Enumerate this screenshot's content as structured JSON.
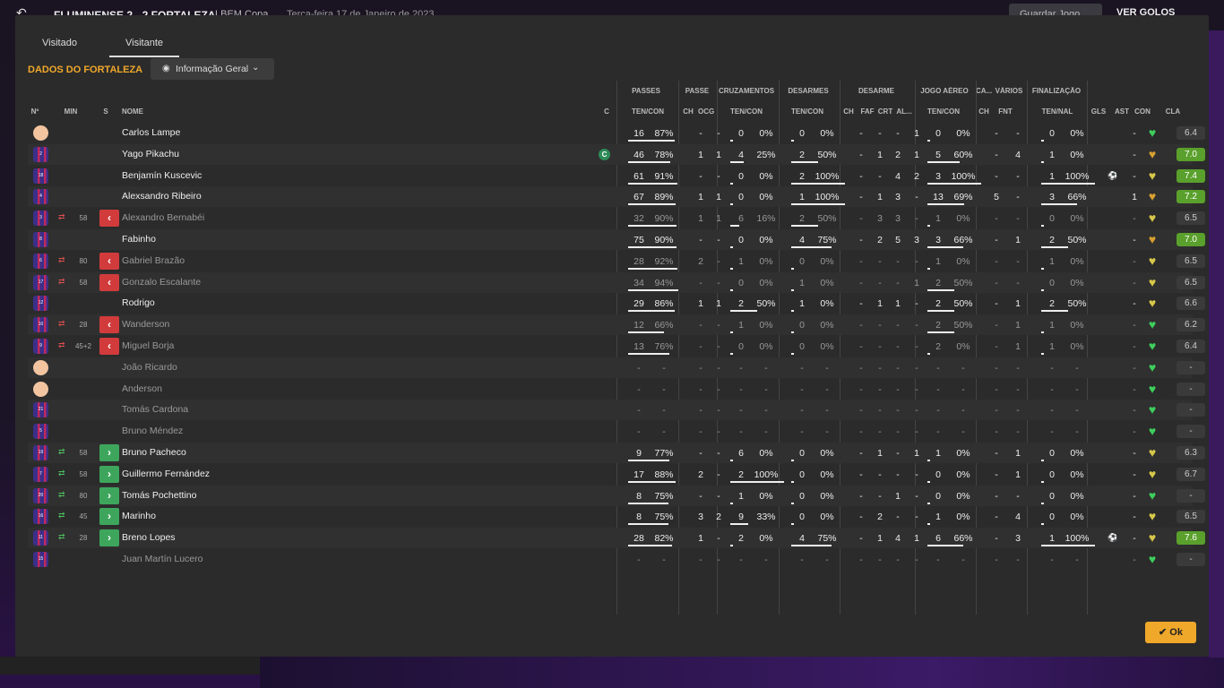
{
  "topbar": {
    "match": "FLUMINENSE  2 - 2  FORTALEZA",
    "competition": "LBEM Copa",
    "date": "Terça-feira 17 de Janeiro de 2023",
    "save_label": "Guardar Jogo",
    "goals_label": "VER GOLOS"
  },
  "tabs": [
    "Visitado",
    "Visitante"
  ],
  "section_title": "DADOS DO FORTALEZA",
  "info_button": "Informação Geral",
  "headers": {
    "left": [
      "Nº",
      "MIN",
      "S",
      "NOME",
      "C"
    ],
    "groups": [
      "PASSES",
      "PASSE",
      "CRUZAMENTOS",
      "DESARMES",
      "DESARME",
      "JOGO AÉREO",
      "CA...",
      "VÁRIOS",
      "FINALIZAÇÃO"
    ],
    "cols": [
      "TEN/CON",
      "CH",
      "OCG",
      "TEN/CON",
      "TEN/CON",
      "CH",
      "FAF",
      "CRT",
      "AL...",
      "TEN/CON",
      "CH",
      "FNT",
      "TEN/NAL",
      "GLS",
      "AST",
      "CON",
      "CLA"
    ]
  },
  "ok_label": "Ok",
  "players": [
    {
      "no": "",
      "face": true,
      "min": "",
      "sub": "",
      "name": "Carlos Lampe",
      "cap": false,
      "dim": false,
      "p": [
        "16",
        "87%"
      ],
      "pb": 0.87,
      "ch": "-",
      "ocg": "-",
      "cr": [
        "0",
        "0%"
      ],
      "crb": 0,
      "ds": [
        "0",
        "0%"
      ],
      "dsb": 0,
      "d": [
        "-",
        "-",
        "-",
        "1"
      ],
      "ja": [
        "0",
        "0%"
      ],
      "jab": 0,
      "ca": "-",
      "fnt": "-",
      "fi": [
        "0",
        "0%"
      ],
      "fib": 0,
      "gls": "",
      "ast": "-",
      "heart": "green",
      "cla": "6.4",
      "good": false
    },
    {
      "no": "2",
      "face": false,
      "min": "",
      "sub": "",
      "name": "Yago Pikachu",
      "cap": true,
      "dim": false,
      "p": [
        "46",
        "78%"
      ],
      "pb": 0.78,
      "ch": "1",
      "ocg": "1",
      "cr": [
        "4",
        "25%"
      ],
      "crb": 0.25,
      "ds": [
        "2",
        "50%"
      ],
      "dsb": 0.5,
      "d": [
        "-",
        "1",
        "2",
        "1"
      ],
      "ja": [
        "5",
        "60%"
      ],
      "jab": 0.6,
      "ca": "-",
      "fnt": "4",
      "fi": [
        "1",
        "0%"
      ],
      "fib": 0,
      "gls": "",
      "ast": "-",
      "heart": "gold",
      "cla": "7.0",
      "good": true
    },
    {
      "no": "18",
      "face": false,
      "min": "",
      "sub": "",
      "name": "Benjamín Kuscevic",
      "cap": false,
      "dim": false,
      "p": [
        "61",
        "91%"
      ],
      "pb": 0.91,
      "ch": "-",
      "ocg": "-",
      "cr": [
        "0",
        "0%"
      ],
      "crb": 0,
      "ds": [
        "2",
        "100%"
      ],
      "dsb": 1,
      "d": [
        "-",
        "-",
        "4",
        "2"
      ],
      "ja": [
        "3",
        "100%"
      ],
      "jab": 1,
      "ca": "-",
      "fnt": "-",
      "fi": [
        "1",
        "100%"
      ],
      "fib": 1,
      "gls": "⚽",
      "ast": "-",
      "heart": "yellow",
      "cla": "7.4",
      "good": true
    },
    {
      "no": "4",
      "face": false,
      "min": "",
      "sub": "",
      "name": "Alexsandro Ribeiro",
      "cap": false,
      "dim": false,
      "p": [
        "67",
        "89%"
      ],
      "pb": 0.89,
      "ch": "1",
      "ocg": "1",
      "cr": [
        "0",
        "0%"
      ],
      "crb": 0,
      "ds": [
        "1",
        "100%"
      ],
      "dsb": 1,
      "d": [
        "-",
        "1",
        "3",
        "-"
      ],
      "ja": [
        "13",
        "69%"
      ],
      "jab": 0.69,
      "ca": "5",
      "fnt": "-",
      "fi": [
        "3",
        "66%"
      ],
      "fib": 0.66,
      "gls": "",
      "ast": "1",
      "heart": "gold",
      "cla": "7.2",
      "good": true
    },
    {
      "no": "3",
      "face": false,
      "min": "58",
      "sub": "out",
      "name": "Alexandro Bernabéi",
      "cap": false,
      "dim": true,
      "p": [
        "32",
        "90%"
      ],
      "pb": 0.9,
      "ch": "1",
      "ocg": "1",
      "cr": [
        "6",
        "16%"
      ],
      "crb": 0.16,
      "ds": [
        "2",
        "50%"
      ],
      "dsb": 0.5,
      "d": [
        "-",
        "3",
        "3",
        "-"
      ],
      "ja": [
        "1",
        "0%"
      ],
      "jab": 0,
      "ca": "-",
      "fnt": "-",
      "fi": [
        "0",
        "0%"
      ],
      "fib": 0,
      "gls": "",
      "ast": "-",
      "heart": "yellow",
      "cla": "6.5",
      "good": false
    },
    {
      "no": "8",
      "face": false,
      "min": "",
      "sub": "",
      "name": "Fabinho",
      "cap": false,
      "dim": false,
      "p": [
        "75",
        "90%"
      ],
      "pb": 0.9,
      "ch": "-",
      "ocg": "-",
      "cr": [
        "0",
        "0%"
      ],
      "crb": 0,
      "ds": [
        "4",
        "75%"
      ],
      "dsb": 0.75,
      "d": [
        "-",
        "2",
        "5",
        "3"
      ],
      "ja": [
        "3",
        "66%"
      ],
      "jab": 0.66,
      "ca": "-",
      "fnt": "1",
      "fi": [
        "2",
        "50%"
      ],
      "fib": 0.5,
      "gls": "",
      "ast": "-",
      "heart": "gold",
      "cla": "7.0",
      "good": true
    },
    {
      "no": "6",
      "face": false,
      "min": "80",
      "sub": "out",
      "name": "Gabriel Brazão",
      "cap": false,
      "dim": true,
      "p": [
        "28",
        "92%"
      ],
      "pb": 0.92,
      "ch": "2",
      "ocg": "-",
      "cr": [
        "1",
        "0%"
      ],
      "crb": 0,
      "ds": [
        "0",
        "0%"
      ],
      "dsb": 0,
      "d": [
        "-",
        "-",
        "-",
        "-"
      ],
      "ja": [
        "1",
        "0%"
      ],
      "jab": 0,
      "ca": "-",
      "fnt": "-",
      "fi": [
        "1",
        "0%"
      ],
      "fib": 0,
      "gls": "",
      "ast": "-",
      "heart": "yellow",
      "cla": "6.5",
      "good": false
    },
    {
      "no": "17",
      "face": false,
      "min": "58",
      "sub": "out",
      "name": "Gonzalo Escalante",
      "cap": false,
      "dim": true,
      "p": [
        "34",
        "94%"
      ],
      "pb": 0.94,
      "ch": "-",
      "ocg": "-",
      "cr": [
        "0",
        "0%"
      ],
      "crb": 0,
      "ds": [
        "1",
        "0%"
      ],
      "dsb": 0,
      "d": [
        "-",
        "-",
        "-",
        "1"
      ],
      "ja": [
        "2",
        "50%"
      ],
      "jab": 0.5,
      "ca": "-",
      "fnt": "-",
      "fi": [
        "0",
        "0%"
      ],
      "fib": 0,
      "gls": "",
      "ast": "-",
      "heart": "yellow",
      "cla": "6.5",
      "good": false
    },
    {
      "no": "12",
      "face": false,
      "min": "",
      "sub": "",
      "name": "Rodrigo",
      "cap": false,
      "dim": false,
      "p": [
        "29",
        "86%"
      ],
      "pb": 0.86,
      "ch": "1",
      "ocg": "1",
      "cr": [
        "2",
        "50%"
      ],
      "crb": 0.5,
      "ds": [
        "1",
        "0%"
      ],
      "dsb": 0,
      "d": [
        "-",
        "1",
        "1",
        "-"
      ],
      "ja": [
        "2",
        "50%"
      ],
      "jab": 0.5,
      "ca": "-",
      "fnt": "1",
      "fi": [
        "2",
        "50%"
      ],
      "fib": 0.5,
      "gls": "",
      "ast": "-",
      "heart": "yellow",
      "cla": "6.6",
      "good": false
    },
    {
      "no": "10",
      "face": false,
      "min": "28",
      "sub": "out",
      "name": "Wanderson",
      "cap": false,
      "dim": true,
      "p": [
        "12",
        "66%"
      ],
      "pb": 0.66,
      "ch": "-",
      "ocg": "-",
      "cr": [
        "1",
        "0%"
      ],
      "crb": 0,
      "ds": [
        "0",
        "0%"
      ],
      "dsb": 0,
      "d": [
        "-",
        "-",
        "-",
        "-"
      ],
      "ja": [
        "2",
        "50%"
      ],
      "jab": 0.5,
      "ca": "-",
      "fnt": "1",
      "fi": [
        "1",
        "0%"
      ],
      "fib": 0,
      "gls": "",
      "ast": "-",
      "heart": "green",
      "cla": "6.2",
      "good": false
    },
    {
      "no": "9",
      "face": false,
      "min": "45+2",
      "sub": "out",
      "name": "Miguel Borja",
      "cap": false,
      "dim": true,
      "p": [
        "13",
        "76%"
      ],
      "pb": 0.76,
      "ch": "-",
      "ocg": "-",
      "cr": [
        "0",
        "0%"
      ],
      "crb": 0,
      "ds": [
        "0",
        "0%"
      ],
      "dsb": 0,
      "d": [
        "-",
        "-",
        "-",
        "-"
      ],
      "ja": [
        "2",
        "0%"
      ],
      "jab": 0,
      "ca": "-",
      "fnt": "1",
      "fi": [
        "1",
        "0%"
      ],
      "fib": 0,
      "gls": "",
      "ast": "-",
      "heart": "green",
      "cla": "6.4",
      "good": false
    },
    {
      "no": "",
      "face": true,
      "min": "",
      "sub": "",
      "name": "João Ricardo",
      "cap": false,
      "dim": true,
      "p": [
        "-",
        "-"
      ],
      "pb": 0,
      "ch": "-",
      "ocg": "-",
      "cr": [
        "-",
        "-"
      ],
      "crb": 0,
      "ds": [
        "-",
        "-"
      ],
      "dsb": 0,
      "d": [
        "-",
        "-",
        "-",
        "-"
      ],
      "ja": [
        "-",
        "-"
      ],
      "jab": 0,
      "ca": "-",
      "fnt": "-",
      "fi": [
        "-",
        "-"
      ],
      "fib": 0,
      "gls": "",
      "ast": "-",
      "heart": "green",
      "cla": "-",
      "good": false
    },
    {
      "no": "",
      "face": true,
      "min": "",
      "sub": "",
      "name": "Anderson",
      "cap": false,
      "dim": true,
      "p": [
        "-",
        "-"
      ],
      "pb": 0,
      "ch": "-",
      "ocg": "-",
      "cr": [
        "-",
        "-"
      ],
      "crb": 0,
      "ds": [
        "-",
        "-"
      ],
      "dsb": 0,
      "d": [
        "-",
        "-",
        "-",
        "-"
      ],
      "ja": [
        "-",
        "-"
      ],
      "jab": 0,
      "ca": "-",
      "fnt": "-",
      "fi": [
        "-",
        "-"
      ],
      "fib": 0,
      "gls": "",
      "ast": "-",
      "heart": "green",
      "cla": "-",
      "good": false
    },
    {
      "no": "21",
      "face": false,
      "min": "",
      "sub": "",
      "name": "Tomás Cardona",
      "cap": false,
      "dim": true,
      "p": [
        "-",
        "-"
      ],
      "pb": 0,
      "ch": "-",
      "ocg": "-",
      "cr": [
        "-",
        "-"
      ],
      "crb": 0,
      "ds": [
        "-",
        "-"
      ],
      "dsb": 0,
      "d": [
        "-",
        "-",
        "-",
        "-"
      ],
      "ja": [
        "-",
        "-"
      ],
      "jab": 0,
      "ca": "-",
      "fnt": "-",
      "fi": [
        "-",
        "-"
      ],
      "fib": 0,
      "gls": "",
      "ast": "-",
      "heart": "green",
      "cla": "-",
      "good": false
    },
    {
      "no": "5",
      "face": false,
      "min": "",
      "sub": "",
      "name": "Bruno Méndez",
      "cap": false,
      "dim": true,
      "p": [
        "-",
        "-"
      ],
      "pb": 0,
      "ch": "-",
      "ocg": "-",
      "cr": [
        "-",
        "-"
      ],
      "crb": 0,
      "ds": [
        "-",
        "-"
      ],
      "dsb": 0,
      "d": [
        "-",
        "-",
        "-",
        "-"
      ],
      "ja": [
        "-",
        "-"
      ],
      "jab": 0,
      "ca": "-",
      "fnt": "-",
      "fi": [
        "-",
        "-"
      ],
      "fib": 0,
      "gls": "",
      "ast": "-",
      "heart": "green",
      "cla": "-",
      "good": false
    },
    {
      "no": "19",
      "face": false,
      "min": "58",
      "sub": "in",
      "name": "Bruno Pacheco",
      "cap": false,
      "dim": false,
      "p": [
        "9",
        "77%"
      ],
      "pb": 0.77,
      "ch": "-",
      "ocg": "-",
      "cr": [
        "6",
        "0%"
      ],
      "crb": 0,
      "ds": [
        "0",
        "0%"
      ],
      "dsb": 0,
      "d": [
        "-",
        "1",
        "-",
        "1"
      ],
      "ja": [
        "1",
        "0%"
      ],
      "jab": 0,
      "ca": "-",
      "fnt": "1",
      "fi": [
        "0",
        "0%"
      ],
      "fib": 0,
      "gls": "",
      "ast": "-",
      "heart": "yellow",
      "cla": "6.3",
      "good": false
    },
    {
      "no": "7",
      "face": false,
      "min": "58",
      "sub": "in",
      "name": "Guillermo Fernández",
      "cap": false,
      "dim": false,
      "p": [
        "17",
        "88%"
      ],
      "pb": 0.88,
      "ch": "2",
      "ocg": "-",
      "cr": [
        "2",
        "100%"
      ],
      "crb": 1,
      "ds": [
        "0",
        "0%"
      ],
      "dsb": 0,
      "d": [
        "-",
        "-",
        "-",
        "-"
      ],
      "ja": [
        "0",
        "0%"
      ],
      "jab": 0,
      "ca": "-",
      "fnt": "1",
      "fi": [
        "0",
        "0%"
      ],
      "fib": 0,
      "gls": "",
      "ast": "-",
      "heart": "yellow",
      "cla": "6.7",
      "good": false
    },
    {
      "no": "20",
      "face": false,
      "min": "80",
      "sub": "in",
      "name": "Tomás Pochettino",
      "cap": false,
      "dim": false,
      "p": [
        "8",
        "75%"
      ],
      "pb": 0.75,
      "ch": "-",
      "ocg": "-",
      "cr": [
        "1",
        "0%"
      ],
      "crb": 0,
      "ds": [
        "0",
        "0%"
      ],
      "dsb": 0,
      "d": [
        "-",
        "-",
        "1",
        "-"
      ],
      "ja": [
        "0",
        "0%"
      ],
      "jab": 0,
      "ca": "-",
      "fnt": "-",
      "fi": [
        "0",
        "0%"
      ],
      "fib": 0,
      "gls": "",
      "ast": "-",
      "heart": "green",
      "cla": "-",
      "good": false
    },
    {
      "no": "16",
      "face": false,
      "min": "45",
      "sub": "in",
      "name": "Marinho",
      "cap": false,
      "dim": false,
      "p": [
        "8",
        "75%"
      ],
      "pb": 0.75,
      "ch": "3",
      "ocg": "2",
      "cr": [
        "9",
        "33%"
      ],
      "crb": 0.33,
      "ds": [
        "0",
        "0%"
      ],
      "dsb": 0,
      "d": [
        "-",
        "2",
        "-",
        "-"
      ],
      "ja": [
        "1",
        "0%"
      ],
      "jab": 0,
      "ca": "-",
      "fnt": "4",
      "fi": [
        "0",
        "0%"
      ],
      "fib": 0,
      "gls": "",
      "ast": "-",
      "heart": "yellow",
      "cla": "6.5",
      "good": false
    },
    {
      "no": "11",
      "face": false,
      "min": "28",
      "sub": "in",
      "name": "Breno Lopes",
      "cap": false,
      "dim": false,
      "p": [
        "28",
        "82%"
      ],
      "pb": 0.82,
      "ch": "1",
      "ocg": "-",
      "cr": [
        "2",
        "0%"
      ],
      "crb": 0,
      "ds": [
        "4",
        "75%"
      ],
      "dsb": 0.75,
      "d": [
        "-",
        "1",
        "4",
        "1"
      ],
      "ja": [
        "6",
        "66%"
      ],
      "jab": 0.66,
      "ca": "-",
      "fnt": "3",
      "fi": [
        "1",
        "100%"
      ],
      "fib": 1,
      "gls": "⚽",
      "ast": "-",
      "heart": "yellow",
      "cla": "7.6",
      "good": true
    },
    {
      "no": "15",
      "face": false,
      "min": "",
      "sub": "",
      "name": "Juan Martín Lucero",
      "cap": false,
      "dim": true,
      "p": [
        "-",
        "-"
      ],
      "pb": 0,
      "ch": "-",
      "ocg": "-",
      "cr": [
        "-",
        "-"
      ],
      "crb": 0,
      "ds": [
        "-",
        "-"
      ],
      "dsb": 0,
      "d": [
        "-",
        "-",
        "-",
        "-"
      ],
      "ja": [
        "-",
        "-"
      ],
      "jab": 0,
      "ca": "-",
      "fnt": "-",
      "fi": [
        "-",
        "-"
      ],
      "fib": 0,
      "gls": "",
      "ast": "-",
      "heart": "green",
      "cla": "-",
      "good": false
    }
  ]
}
